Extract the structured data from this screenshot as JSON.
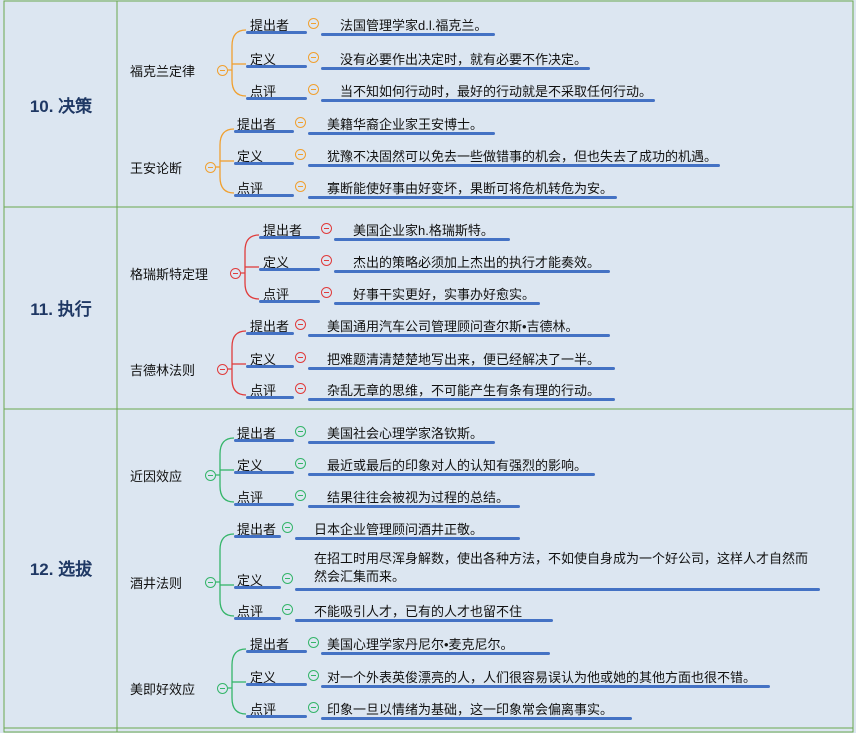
{
  "colors": {
    "background": "#dce6f1",
    "grid_line": "#6aa84f",
    "title_text": "#1f3864",
    "underline": "#4472c4",
    "branch_decision": "#f0a030",
    "branch_execution": "#e03c3c",
    "branch_selection": "#35b56a"
  },
  "sections": [
    {
      "id": "decision",
      "title": "10. 决策",
      "laws": [
        {
          "name": "福克兰定律",
          "items": [
            {
              "label": "提出者",
              "text": "法国管理学家d.l.福克兰。"
            },
            {
              "label": "定义",
              "text": "没有必要作出决定时，就有必要不作决定。"
            },
            {
              "label": "点评",
              "text": "当不知如何行动时，最好的行动就是不采取任何行动。"
            }
          ]
        },
        {
          "name": "王安论断",
          "items": [
            {
              "label": "提出者",
              "text": "美籍华裔企业家王安博士。"
            },
            {
              "label": "定义",
              "text": "犹豫不决固然可以免去一些做错事的机会，但也失去了成功的机遇。"
            },
            {
              "label": "点评",
              "text": "寡断能使好事由好变坏，果断可将危机转危为安。"
            }
          ]
        }
      ]
    },
    {
      "id": "execution",
      "title": "11. 执行",
      "laws": [
        {
          "name": "格瑞斯特定理",
          "items": [
            {
              "label": "提出者",
              "text": "美国企业家h.格瑞斯特。"
            },
            {
              "label": "定义",
              "text": "杰出的策略必须加上杰出的执行才能奏效。"
            },
            {
              "label": "点评",
              "text": "好事干实更好，实事办好愈实。"
            }
          ]
        },
        {
          "name": "吉德林法则",
          "items": [
            {
              "label": "提出者",
              "text": "美国通用汽车公司管理顾问查尔斯•吉德林。"
            },
            {
              "label": "定义",
              "text": "把难题清清楚楚地写出来，便已经解决了一半。"
            },
            {
              "label": "点评",
              "text": "杂乱无章的思维，不可能产生有条有理的行动。"
            }
          ]
        }
      ]
    },
    {
      "id": "selection",
      "title": "12. 选拔",
      "laws": [
        {
          "name": "近因效应",
          "items": [
            {
              "label": "提出者",
              "text": "美国社会心理学家洛钦斯。"
            },
            {
              "label": "定义",
              "text": "最近或最后的印象对人的认知有强烈的影响。"
            },
            {
              "label": "点评",
              "text": "结果往往会被视为过程的总结。"
            }
          ]
        },
        {
          "name": "酒井法则",
          "items": [
            {
              "label": "提出者",
              "text": "日本企业管理顾问酒井正敬。"
            },
            {
              "label": "定义",
              "text": "在招工时用尽浑身解数，使出各种方法，不如使自身成为一个好公司，这样人才自然而然会汇集而来。"
            },
            {
              "label": "点评",
              "text": "不能吸引人才，已有的人才也留不住"
            }
          ]
        },
        {
          "name": "美即好效应",
          "items": [
            {
              "label": "提出者",
              "text": "美国心理学家丹尼尔•麦克尼尔。"
            },
            {
              "label": "定义",
              "text": "对一个外表英俊漂亮的人，人们很容易误认为他或她的其他方面也很不错。"
            },
            {
              "label": "点评",
              "text": "印象一旦以情绪为基础，这一印象常会偏离事实。"
            }
          ]
        }
      ]
    }
  ]
}
